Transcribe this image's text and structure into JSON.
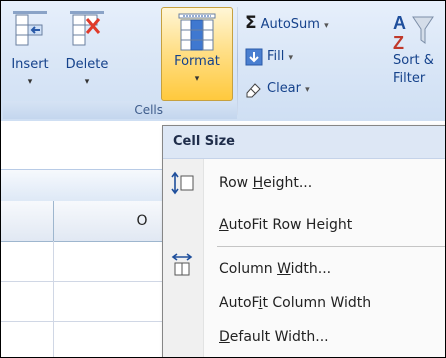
{
  "ribbon": {
    "insert": {
      "label": "Insert",
      "arrow": "▾"
    },
    "delete": {
      "label": "Delete",
      "arrow": "▾"
    },
    "format": {
      "label": "Format",
      "arrow": "▾"
    },
    "cells_group_label": "Cells",
    "editing": {
      "autosum": "AutoSum",
      "autosum_arrow": "▾",
      "fill": "Fill",
      "fill_arrow": "▾",
      "clear": "Clear",
      "clear_arrow": "▾",
      "sort_label_line1": "Sort &",
      "sort_label_line2": "Filter",
      "sigma_glyph": "Σ",
      "sort_glyph": "A Z"
    }
  },
  "sheet": {
    "column_o": "O"
  },
  "menu": {
    "heading": "Cell Size",
    "items": [
      {
        "pre": "Row ",
        "ul": "H",
        "post": "eight...",
        "icon": "row-height-icon"
      },
      {
        "pre": "",
        "ul": "A",
        "post": "utoFit Row Height",
        "icon": ""
      },
      {
        "pre": "Column ",
        "ul": "W",
        "post": "idth...",
        "icon": "column-width-icon"
      },
      {
        "pre": "AutoF",
        "ul": "i",
        "post": "t Column Width",
        "icon": ""
      },
      {
        "pre": "",
        "ul": "D",
        "post": "efault Width...",
        "icon": ""
      }
    ]
  },
  "colors": {
    "ribbon_text": "#15428b",
    "format_active_top": "#fff6d6",
    "format_active_bottom": "#ffc93d",
    "menu_heading_bg": "#dde7f5"
  }
}
